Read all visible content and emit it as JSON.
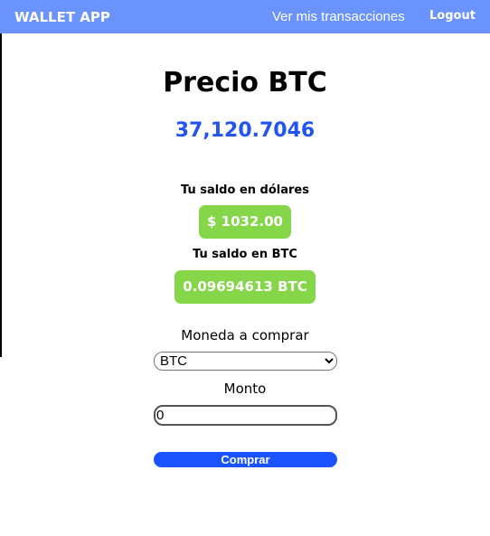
{
  "nav": {
    "brand": "WALLET APP",
    "transactions": "Ver mis transacciones",
    "logout": "Logout"
  },
  "main": {
    "title": "Precio BTC",
    "price": "37,120.7046",
    "usd_label": "Tu saldo en dólares",
    "usd_value": "$ 1032.00",
    "btc_label": "Tu saldo en BTC",
    "btc_value": "0.09694613 BTC",
    "currency_label": "Moneda a comprar",
    "currency_selected": "BTC",
    "amount_label": "Monto",
    "amount_value": "0",
    "buy_label": "Comprar"
  }
}
